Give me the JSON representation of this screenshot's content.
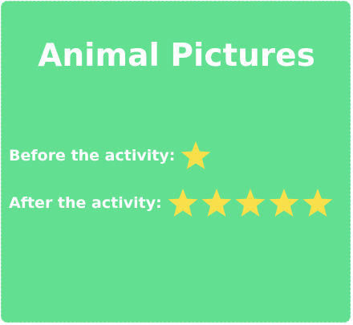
{
  "card": {
    "title": "Animal Pictures",
    "background_color": "#63df92",
    "star_color": "#f9e04a"
  },
  "ratings": [
    {
      "label": "Before the activity:",
      "stars": 1,
      "star_icon": "star-icon"
    },
    {
      "label": "After the activity:",
      "stars": 5,
      "star_icon": "star-icon"
    }
  ]
}
